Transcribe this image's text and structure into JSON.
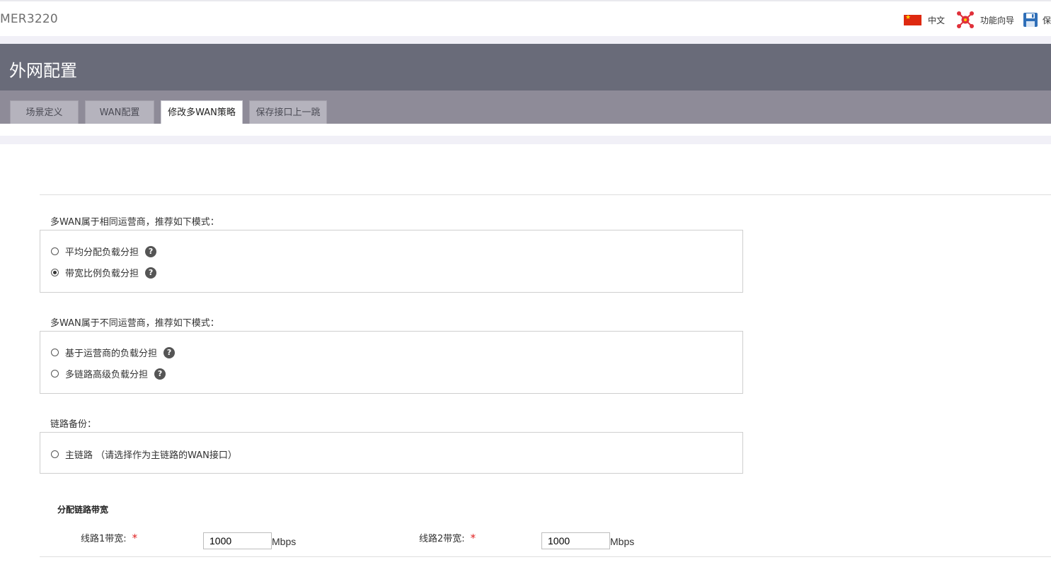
{
  "topbar": {
    "brand": "MER3220",
    "language": "中文",
    "wizard": "功能向导",
    "save": "保"
  },
  "header": {
    "title": "外网配置"
  },
  "tabs": [
    {
      "label": "场景定义",
      "active": false
    },
    {
      "label": "WAN配置",
      "active": false
    },
    {
      "label": "修改多WAN策略",
      "active": true
    },
    {
      "label": "保存接口上一跳",
      "active": false
    }
  ],
  "sections": {
    "same_isp": {
      "label": "多WAN属于相同运营商，推荐如下模式：",
      "options": [
        {
          "label": "平均分配负载分担",
          "checked": false
        },
        {
          "label": "带宽比例负载分担",
          "checked": true
        }
      ]
    },
    "diff_isp": {
      "label": "多WAN属于不同运营商，推荐如下模式：",
      "options": [
        {
          "label": "基于运营商的负载分担",
          "checked": false
        },
        {
          "label": "多链路高级负载分担",
          "checked": false
        }
      ]
    },
    "backup": {
      "label": "链路备份：",
      "options": [
        {
          "label": "主链路 （请选择作为主链路的WAN接口）",
          "checked": false
        }
      ]
    }
  },
  "bandwidth": {
    "title": "分配链路带宽",
    "required_mark": "*",
    "unit": "Mbps",
    "line1": {
      "label": "线路1带宽:",
      "value": "1000"
    },
    "line2": {
      "label": "线路2带宽:",
      "value": "1000"
    }
  },
  "icons": {
    "help": "?"
  },
  "colors": {
    "header_bg": "#696b79",
    "tabbar_bg": "#8e8b98",
    "required": "#e02020"
  }
}
